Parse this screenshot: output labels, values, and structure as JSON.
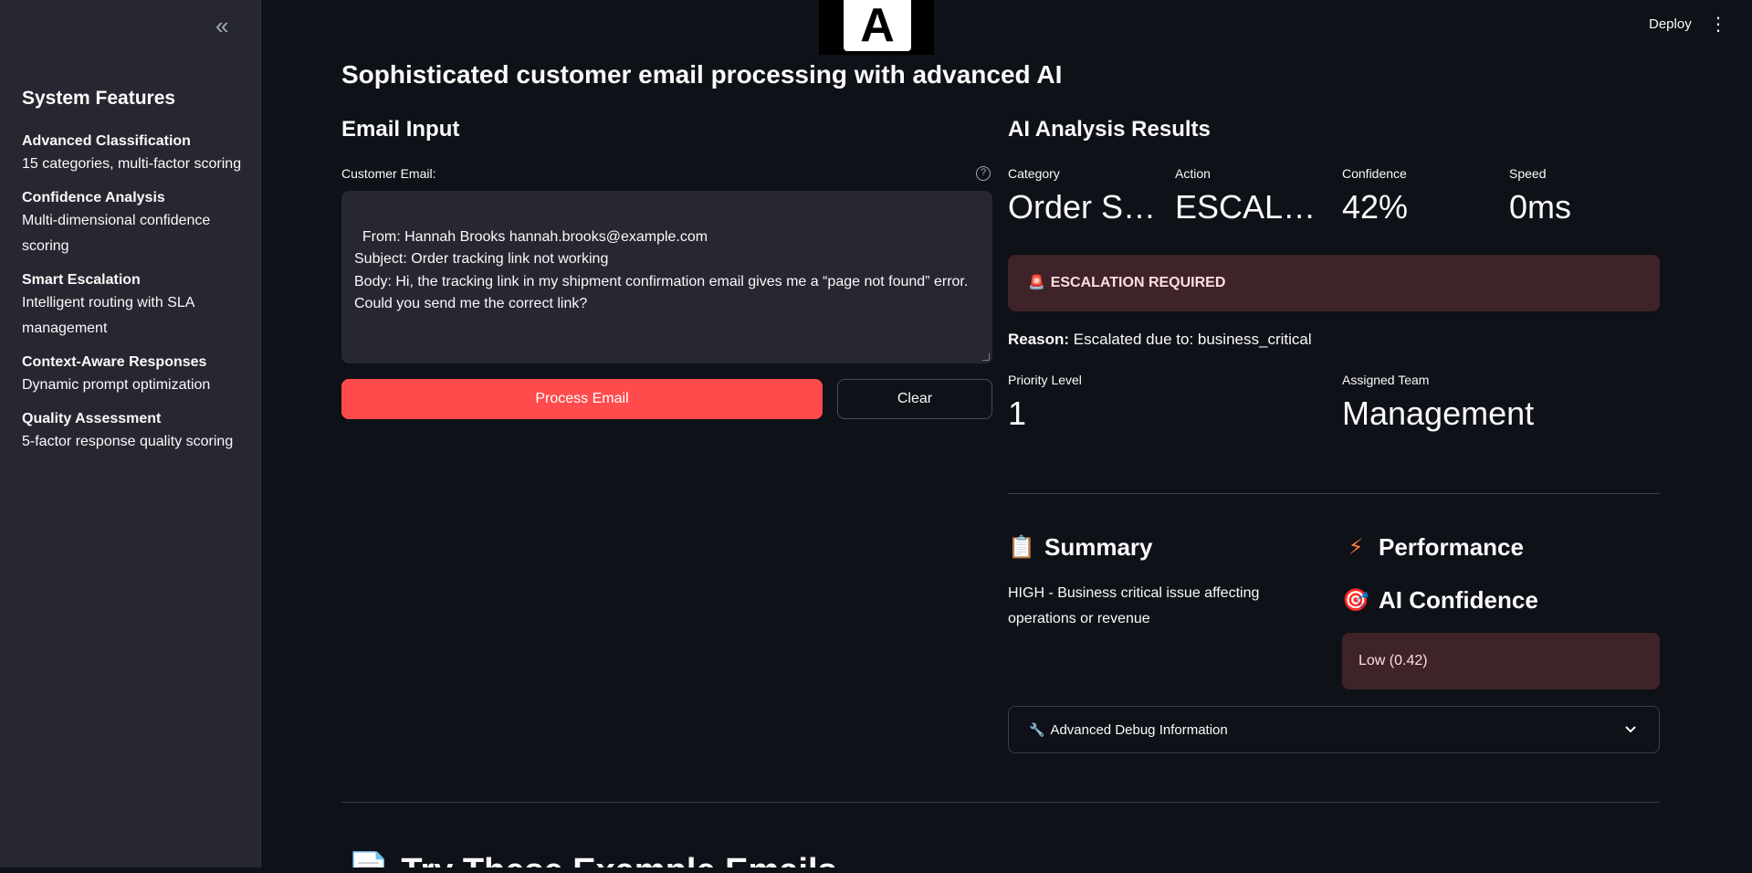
{
  "sidebar": {
    "collapse_icon": "«",
    "title": "System Features",
    "features": [
      {
        "name": "Advanced Classification",
        "desc": "15 categories, multi-factor scoring"
      },
      {
        "name": "Confidence Analysis",
        "desc": "Multi-dimensional confidence scoring"
      },
      {
        "name": "Smart Escalation",
        "desc": "Intelligent routing with SLA management"
      },
      {
        "name": "Context-Aware Responses",
        "desc": "Dynamic prompt optimization"
      },
      {
        "name": "Quality Assessment",
        "desc": "5-factor response quality scoring"
      }
    ]
  },
  "header": {
    "logo_letter": "A",
    "deploy_label": "Deploy",
    "menu_icon": "⋮"
  },
  "page_title": "Sophisticated customer email processing with advanced AI",
  "email_input": {
    "heading": "Email Input",
    "label": "Customer Email:",
    "help_icon": "?",
    "value": "From: Hannah Brooks hannah.brooks@example.com\nSubject: Order tracking link not working\nBody: Hi, the tracking link in my shipment confirmation email gives me a “page not found” error. Could you send me the correct link?",
    "process_label": "Process Email",
    "clear_label": "Clear"
  },
  "results": {
    "heading": "AI Analysis Results",
    "metrics": [
      {
        "label": "Category",
        "value": "Order S…"
      },
      {
        "label": "Action",
        "value": "ESCALA…"
      },
      {
        "label": "Confidence",
        "value": "42%"
      },
      {
        "label": "Speed",
        "value": "0ms"
      }
    ],
    "escalation_icon": "🚨",
    "escalation_text": "ESCALATION REQUIRED",
    "reason_label": "Reason:",
    "reason_text": " Escalated due to: business_critical",
    "priority_label": "Priority Level",
    "priority_value": "1",
    "team_label": "Assigned Team",
    "team_value": "Management"
  },
  "summary": {
    "icon": "📋",
    "heading": "Summary",
    "text": "HIGH - Business critical issue affecting operations or revenue"
  },
  "performance": {
    "icon": "⚡",
    "heading": "Performance"
  },
  "ai_confidence": {
    "icon": "🎯",
    "heading": "AI Confidence",
    "value": "Low (0.42)"
  },
  "debug": {
    "icon": "🔧",
    "label": "Advanced Debug Information",
    "chevron": "⌄"
  },
  "examples": {
    "icon": "📄",
    "heading": "Try These Example Emails"
  }
}
